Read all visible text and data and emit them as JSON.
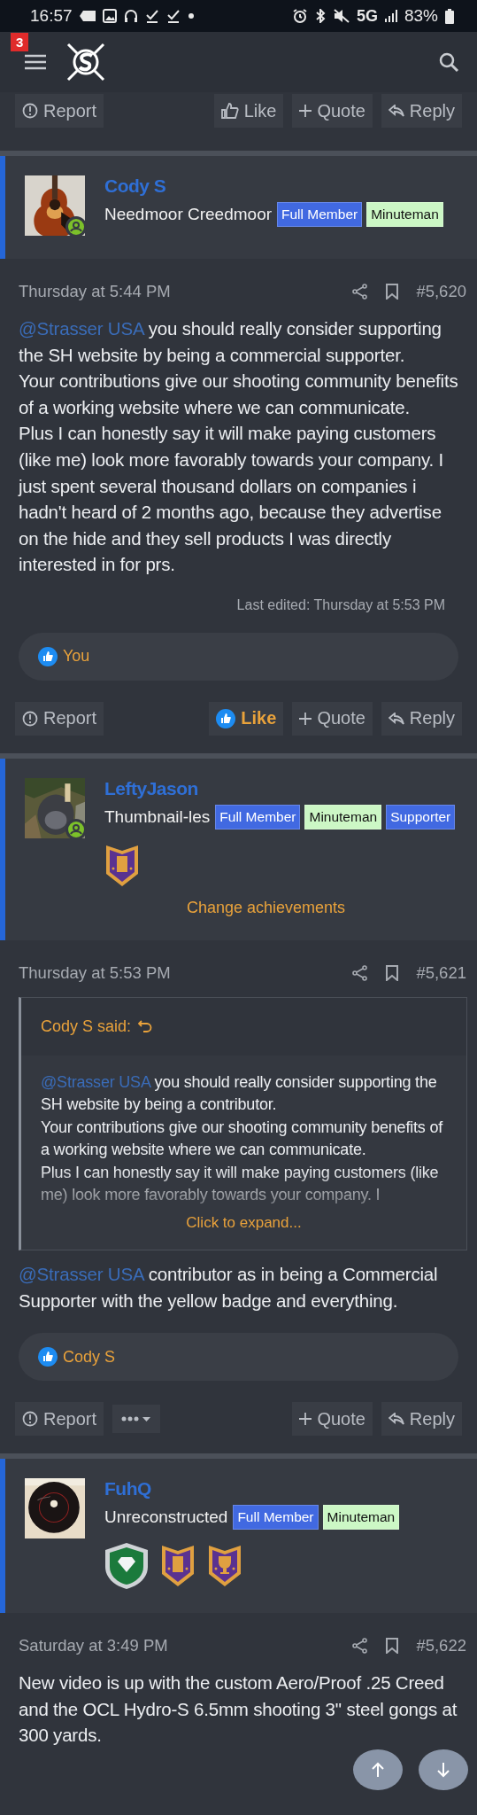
{
  "status_bar": {
    "time": "16:57",
    "network": "5G",
    "battery": "83%"
  },
  "header": {
    "notification_count": "3"
  },
  "top_actions": [
    {
      "kind": "report",
      "label": "Report"
    },
    {
      "kind": "like",
      "label": "Like",
      "liked": false
    },
    {
      "kind": "quote",
      "label": "Quote"
    },
    {
      "kind": "reply",
      "label": "Reply"
    }
  ],
  "posts": [
    {
      "username": "Cody S",
      "user_title": "Needmoor Creedmoor",
      "online": true,
      "banners": [
        {
          "label": "Full Member",
          "color": "#4169e1"
        },
        {
          "label": "Minuteman",
          "color": "#ccf7c5"
        }
      ],
      "date": "Thursday at 5:44 PM",
      "number": "#5,620",
      "body": [
        {
          "mention": "@Strasser USA",
          "text": " you should really consider supporting the SH website by being a commercial supporter."
        },
        {
          "text": "Your contributions give our shooting community benefits of a working website where we can communicate."
        },
        {
          "text": "Plus I can honestly say it will make paying customers (like me) look more favorably towards your company. I just spent several thousand dollars on companies i hadn't heard of 2 months ago, because they advertise on the hide and they sell products I was directly interested in for prs."
        }
      ],
      "last_edited": "Last edited: Thursday at 5:53 PM",
      "reactions": "You",
      "actions": [
        {
          "kind": "report",
          "label": "Report"
        },
        {
          "kind": "like",
          "label": "Like",
          "liked": true
        },
        {
          "kind": "quote",
          "label": "Quote"
        },
        {
          "kind": "reply",
          "label": "Reply"
        }
      ]
    },
    {
      "username": "LeftyJason",
      "user_title": "Thumbnail-les",
      "online": true,
      "banners": [
        {
          "label": "Full Member",
          "color": "#4169e1"
        },
        {
          "label": "Minuteman",
          "color": "#ccf7c5"
        },
        {
          "label": "Supporter",
          "color": "#4169e1"
        }
      ],
      "trophies": [
        {
          "kind": "vest"
        }
      ],
      "change_achievements": "Change achievements",
      "date": "Thursday at 5:53 PM",
      "number": "#5,621",
      "quote": {
        "author": "Cody S said:",
        "paragraphs": [
          {
            "mention": "@Strasser USA",
            "text": " you should really consider supporting the SH website by being a contributor."
          },
          {
            "text": "Your contributions give our shooting community benefits of a working website where we can communicate."
          },
          {
            "text": "Plus I can honestly say it will make paying customers (like me) look more favorably towards your company. I"
          }
        ],
        "expand": "Click to expand..."
      },
      "body": [
        {
          "mention": "@Strasser USA",
          "text": " contributor as in being a Commercial Supporter with the yellow badge and everything."
        }
      ],
      "reactions": "Cody S",
      "actions": [
        {
          "kind": "report",
          "label": "Report"
        },
        {
          "kind": "more"
        },
        {
          "kind": "quote",
          "label": "Quote"
        },
        {
          "kind": "reply",
          "label": "Reply"
        }
      ]
    },
    {
      "username": "FuhQ",
      "user_title": "Unreconstructed",
      "online": false,
      "banners": [
        {
          "label": "Full Member",
          "color": "#4169e1"
        },
        {
          "label": "Minuteman",
          "color": "#ccf7c5"
        }
      ],
      "trophies": [
        {
          "kind": "gem"
        },
        {
          "kind": "vest"
        },
        {
          "kind": "trophy"
        }
      ],
      "date": "Saturday at 3:49 PM",
      "number": "#5,622",
      "body": [
        {
          "text": "New video is up with the custom Aero/Proof .25 Creed and the OCL Hydro-S 6.5mm shooting 3\" steel gongs at 300 yards."
        }
      ]
    }
  ]
}
